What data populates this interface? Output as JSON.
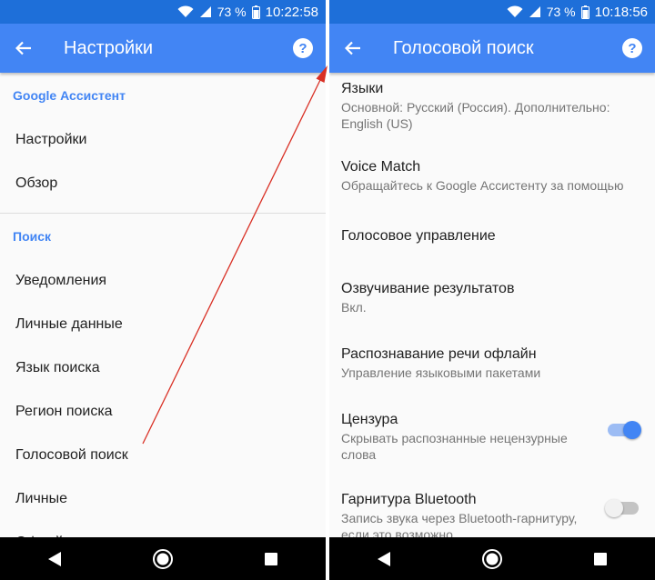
{
  "status": {
    "battery_percent": "73 %",
    "left_time": "10:22:58",
    "right_time": "10:18:56",
    "bar_color": "#1e6fd9"
  },
  "colors": {
    "app_bar": "#4285f4",
    "accent": "#4285f4",
    "annotation_arrow": "#d93025"
  },
  "left": {
    "title": "Настройки",
    "help_label": "?",
    "sections": [
      {
        "header": "Google Ассистент",
        "items": [
          "Настройки",
          "Обзор"
        ]
      },
      {
        "header": "Поиск",
        "items": [
          "Уведомления",
          "Личные данные",
          "Язык поиска",
          "Регион поиска",
          "Голосовой поиск",
          "Личные",
          "Офлайн-поиск"
        ]
      }
    ]
  },
  "right": {
    "title": "Голосовой поиск",
    "help_label": "?",
    "items": [
      {
        "title": "Языки",
        "subtitle": "Основной: Русский (Россия). Дополнительно: English (US)"
      },
      {
        "title": "Voice Match",
        "subtitle": "Обращайтесь к Google Ассистенту за помощью"
      },
      {
        "title": "Голосовое управление"
      },
      {
        "title": "Озвучивание результатов",
        "subtitle": "Вкл."
      },
      {
        "title": "Распознавание речи офлайн",
        "subtitle": "Управление языковыми пакетами"
      },
      {
        "title": "Цензура",
        "subtitle": "Скрывать распознанные нецензурные слова",
        "switch": "on"
      },
      {
        "title": "Гарнитура Bluetooth",
        "subtitle": "Запись звука через Bluetooth-гарнитуру, если это возможно",
        "switch": "off"
      }
    ]
  },
  "icons": {
    "status": [
      "wifi-icon",
      "signal-icon",
      "battery-icon"
    ],
    "app_bar": [
      "back-arrow-icon",
      "help-icon"
    ],
    "nav": [
      "nav-back-icon",
      "nav-home-icon",
      "nav-recents-icon"
    ]
  }
}
